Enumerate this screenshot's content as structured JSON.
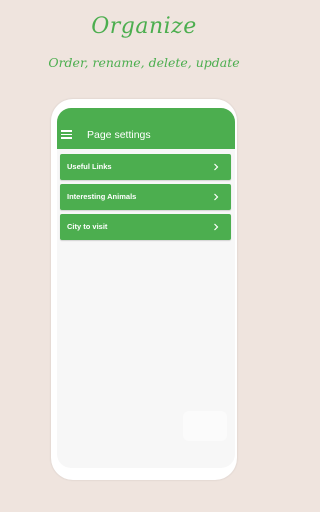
{
  "promo": {
    "title": "Organize",
    "subtitle": "Order, rename, delete, update"
  },
  "app_bar": {
    "title": "Page settings",
    "menu_icon": "hamburger-menu-icon"
  },
  "pages": [
    {
      "label": "Useful Links"
    },
    {
      "label": "Interesting Animals"
    },
    {
      "label": "City to visit"
    }
  ],
  "colors": {
    "accent": "#4cae4f",
    "background": "#efe4de",
    "screen": "#f7f7f7"
  }
}
